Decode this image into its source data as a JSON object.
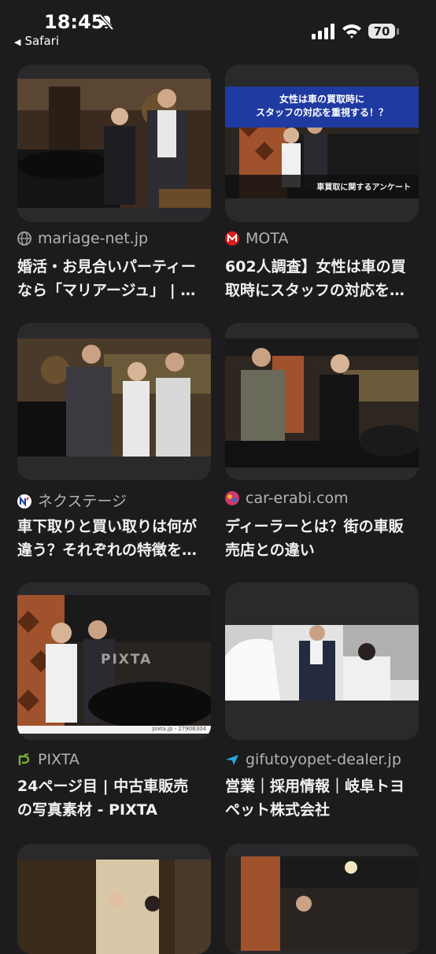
{
  "status_bar": {
    "time": "18:45",
    "back_app": "Safari",
    "battery": "70"
  },
  "results": [
    {
      "source": "mariage-net.jp",
      "favicon": "globe-icon",
      "title_line1": "婚活・お見合いパーティー",
      "title_line2": "なら「マリアージュ」 | …",
      "image_desc": "couple-in-car-showroom"
    },
    {
      "source": "MOTA",
      "favicon": "mota-logo-icon",
      "title_line1": "602人調査】女性は車の買",
      "title_line2": "取時にスタッフの対応を…",
      "image_banner_line1": "女性は車の買取時に",
      "image_banner_line2": "スタッフの対応を重視する！？",
      "image_caption": "車買取に関するアンケート"
    },
    {
      "source": "ネクステージ",
      "favicon": "nextage-logo-icon",
      "title_line1": "車下取りと買い取りは何が",
      "title_line2": "違う？それぞれの特徴を…",
      "image_desc": "salesman-with-couple"
    },
    {
      "source": "car-erabi.com",
      "favicon": "car-erabi-logo-icon",
      "title_line1": "ディーラーとは？街の車販",
      "title_line2": "売店との違い",
      "image_desc": "mechanic-handshake"
    },
    {
      "source": "PIXTA",
      "favicon": "pixta-logo-icon",
      "title_line1": "24ページ目 | 中古車販売",
      "title_line2": "の写真素材 - PIXTA",
      "image_watermark": "PIXTA",
      "image_credit": "pixta.jp - 27906304"
    },
    {
      "source": "gifutoyopet-dealer.jp",
      "favicon": "gifu-toyopet-logo-icon",
      "title_line1": "営業｜採用情報｜岐阜トヨ",
      "title_line2": "ペット株式会社",
      "image_desc": "dealer-with-customer"
    }
  ],
  "colors": {
    "background": "#1c1c1e",
    "card": "#2a2a2c",
    "text": "#f2f2f2",
    "muted": "#b3b3b3",
    "mota_red": "#d81e1e",
    "banner_blue": "#1f3aa0"
  }
}
